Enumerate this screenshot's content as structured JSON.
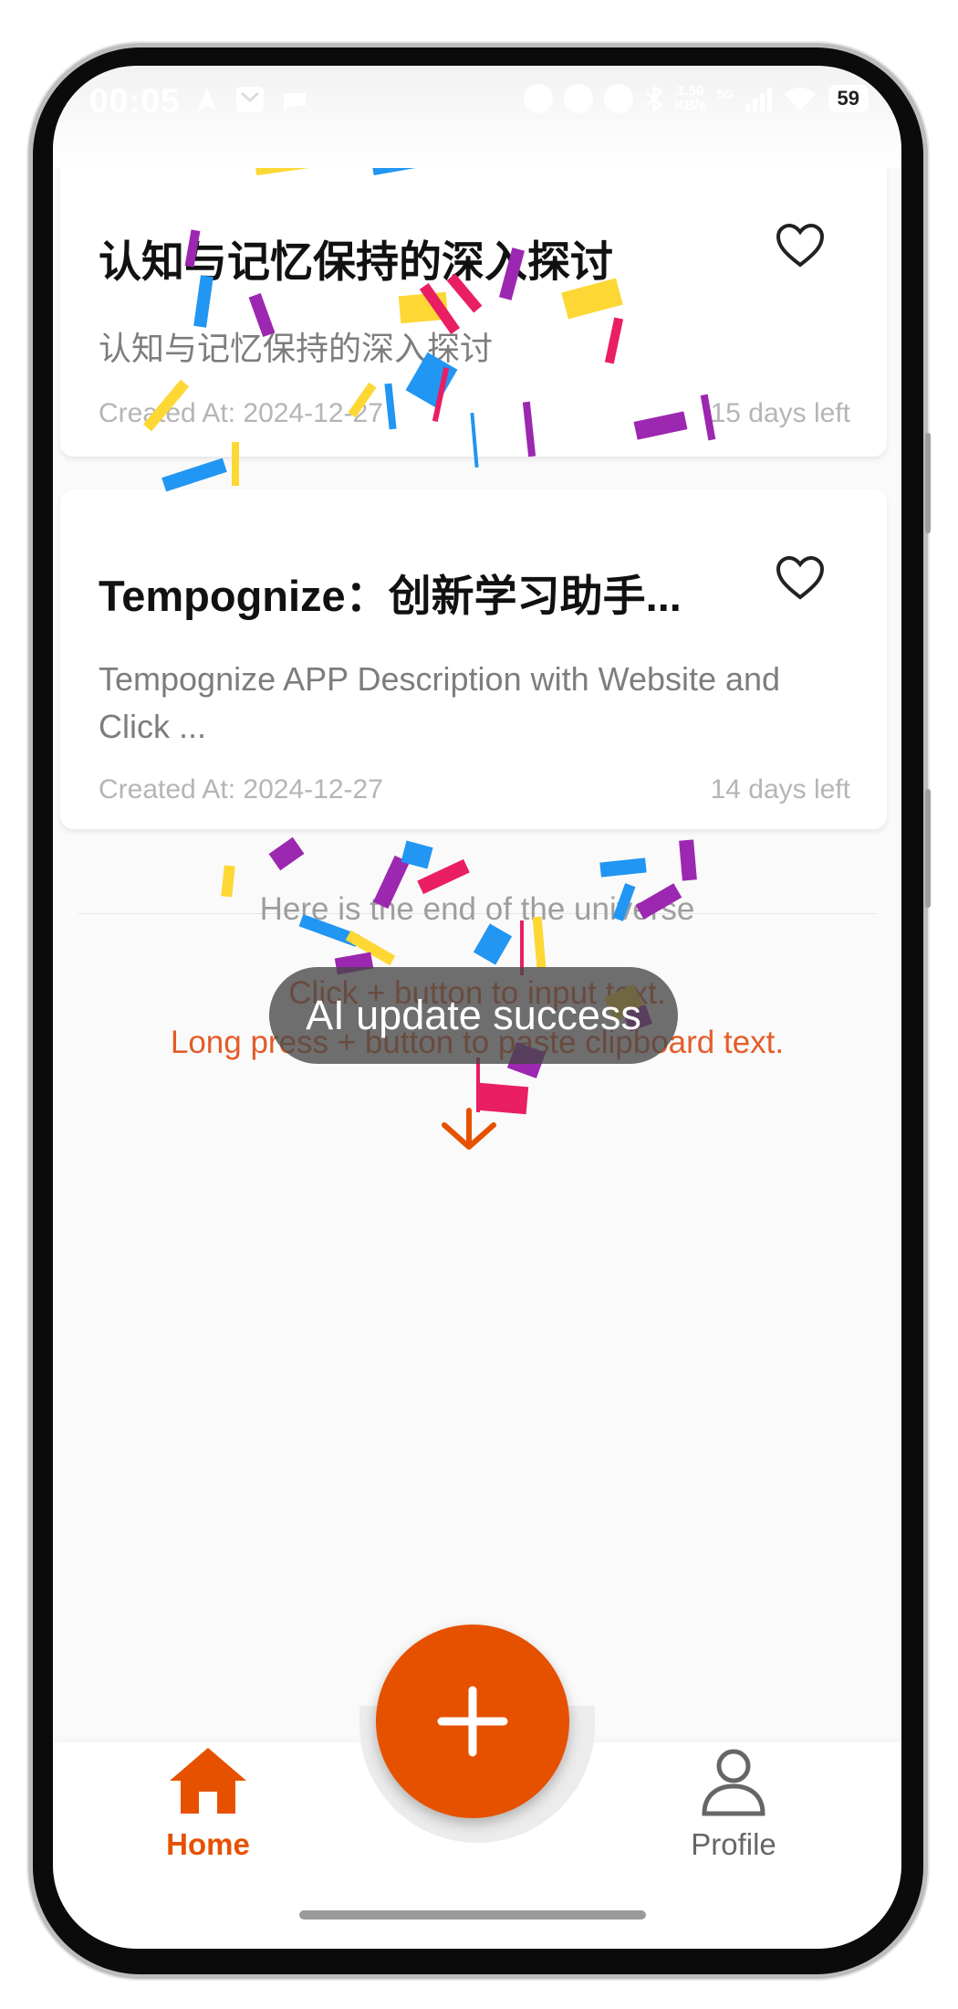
{
  "status_bar": {
    "time": "00:05",
    "network_speed_value": "1.50",
    "network_speed_unit": "KB/s",
    "network_type": "5G",
    "battery": "59"
  },
  "cards": [
    {
      "title": "认知与记忆保持的深入探讨",
      "description": "认知与记忆保持的深入探讨",
      "created_at": "Created At: 2024-12-27",
      "days_left": "15 days left"
    },
    {
      "title": "Tempognize：创新学习助手...",
      "description": "Tempognize APP Description with Website and Click ...",
      "created_at": "Created At: 2024-12-27",
      "days_left": "14 days left"
    }
  ],
  "end_message": "Here is the end of the universe",
  "hint_click": "Click + button to input text.",
  "hint_long_press": "Long press + button to paste clipboard text.",
  "toast": "AI update success",
  "bottom_nav": {
    "home_label": "Home",
    "profile_label": "Profile",
    "fab_label": "+"
  },
  "colors": {
    "accent": "#e65100",
    "hint_text": "#e35d2a",
    "card_bg": "#ffffff",
    "screen_bg": "#fafafa"
  }
}
